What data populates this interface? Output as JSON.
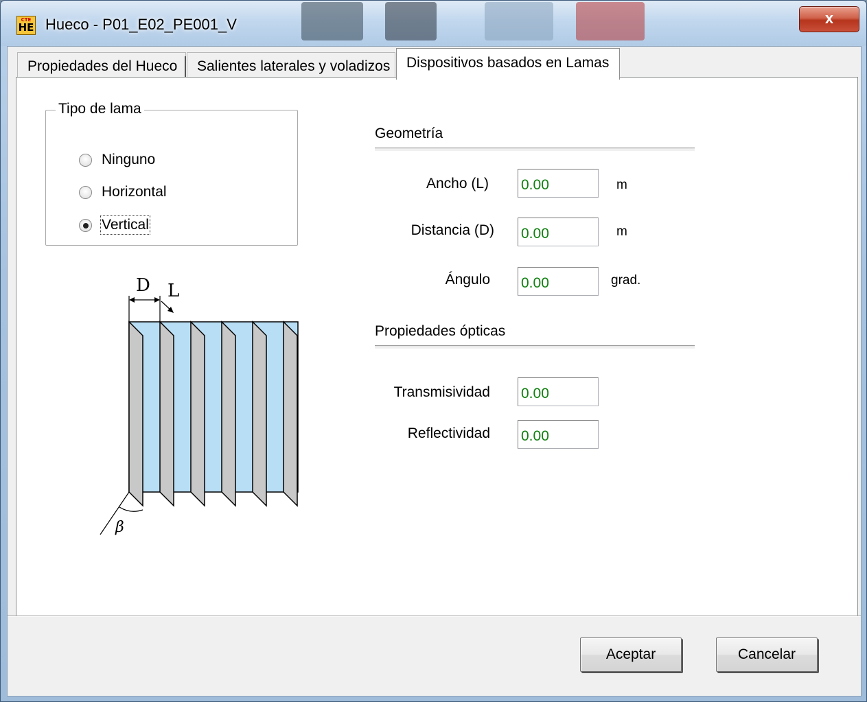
{
  "window": {
    "app_icon_small": "CTE",
    "app_icon_big": "HE",
    "title": "Hueco - P01_E02_PE001_V",
    "close_glyph": "x"
  },
  "tabs": [
    {
      "label": "Propiedades del Hueco",
      "active": false
    },
    {
      "label": "Salientes laterales y voladizos",
      "active": false
    },
    {
      "label": "Dispositivos basados en Lamas",
      "active": true
    }
  ],
  "lama": {
    "group_title": "Tipo de lama",
    "options": [
      {
        "label": "Ninguno",
        "checked": false
      },
      {
        "label": "Horizontal",
        "checked": false
      },
      {
        "label": "Vertical",
        "checked": true
      }
    ]
  },
  "diagram": {
    "label_d": "D",
    "label_l": "L",
    "label_beta": "β"
  },
  "geometria": {
    "title": "Geometría",
    "fields": [
      {
        "label": "Ancho (L)",
        "value": "0.00",
        "unit": "m"
      },
      {
        "label": "Distancia (D)",
        "value": "0.00",
        "unit": "m"
      },
      {
        "label": "Ángulo",
        "value": "0.00",
        "unit": "grad."
      }
    ]
  },
  "opticas": {
    "title": "Propiedades ópticas",
    "fields": [
      {
        "label": "Transmisividad",
        "value": "0.00"
      },
      {
        "label": "Reflectividad",
        "value": "0.00"
      }
    ]
  },
  "buttons": {
    "accept": "Aceptar",
    "cancel": "Cancelar"
  },
  "colors": {
    "value_text": "#108010",
    "glass": "#b8def5",
    "close_button": "#c9503a"
  }
}
